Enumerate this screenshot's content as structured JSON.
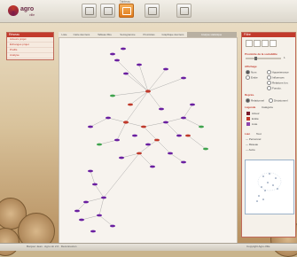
{
  "header": {
    "logo_text": "agro",
    "logo_sub": "ville",
    "buttons": [
      {
        "label": "",
        "active": false
      },
      {
        "label": "",
        "active": false
      },
      {
        "label": "Tableau",
        "active": true
      },
      {
        "label": "",
        "active": false
      },
      {
        "label": "",
        "active": false
      }
    ]
  },
  "left_panel": {
    "title": "Réseau",
    "items": [
      "Acteurs projet",
      "Échanges projet",
      "Profils",
      "Analyse"
    ]
  },
  "tabs": [
    {
      "label": "Liste",
      "active": false
    },
    {
      "label": "Carte des liens",
      "active": false
    },
    {
      "label": "Tableau filtre",
      "active": false
    },
    {
      "label": "Sociogramme",
      "active": false
    },
    {
      "label": "Proximites",
      "active": false
    },
    {
      "label": "Graphique des liens",
      "active": false
    },
    {
      "label": "Analyse statistique",
      "active": true
    }
  ],
  "right_panel": {
    "title": "Filtre",
    "section_filter": "Proximite de la sociabilite",
    "slider_value": "1",
    "section_display": "Affichage",
    "options_display": [
      {
        "label": "Nom",
        "on": true
      },
      {
        "label": "Entite",
        "on": false
      },
      {
        "label": "Appartenance",
        "on": false
      },
      {
        "label": "Influences",
        "on": false
      },
      {
        "label": "Relations fon.",
        "on": false
      },
      {
        "label": "Fonctio.",
        "on": false
      }
    ],
    "section_repres": "Représ.",
    "options_repres": [
      {
        "label": "Relationnel",
        "on": true
      },
      {
        "label": "Décisionnel",
        "on": false
      }
    ],
    "section_legend": "Légende",
    "legend_type": "Catégorie",
    "legend_items": [
      "Acteur",
      "Entité",
      "Liste"
    ],
    "section_links": "Lien",
    "links_type": "Tout",
    "link_items": [
      "Personnel",
      "Réseau",
      "Autre"
    ]
  },
  "status": {
    "left": "Bonjour Jean · Agro vin 2.0 · Deconnexion",
    "right": "Copyright Agro-Ville"
  },
  "colors": {
    "node_purple": "#6a1fa0",
    "node_red": "#c0392b",
    "node_green": "#3fa34d",
    "edge": "#9a9a9a",
    "accent_red": "#c23a2c"
  }
}
